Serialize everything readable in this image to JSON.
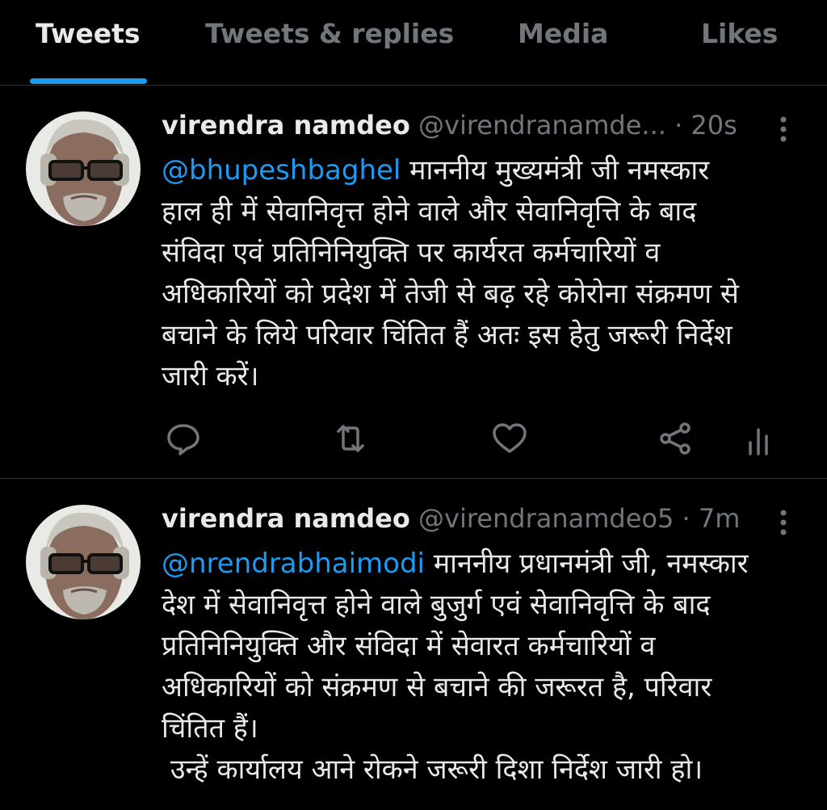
{
  "tabs": [
    {
      "label": "Tweets",
      "active": true
    },
    {
      "label": "Tweets & replies",
      "active": false
    },
    {
      "label": "Media",
      "active": false
    },
    {
      "label": "Likes",
      "active": false
    }
  ],
  "tweets": [
    {
      "author_name": "virendra namdeo",
      "author_handle": "@virendranamde...",
      "separator": " · ",
      "time": "20s",
      "mention": "@bhupeshbaghel",
      "text": " माननीय मुख्यमंत्री जी नमस्कार\nहाल ही में सेवानिवृत्त होने वाले और सेवानिवृत्ति के बाद\nसंविदा एवं प्रतिनिनियुक्ति पर कार्यरत कर्मचारियों व\nअधिकारियों को प्रदेश में तेजी से बढ़ रहे कोरोना संक्रमण से\nबचाने के लिये परिवार चिंतित हैं अतः इस हेतु जरूरी निर्देश\nजारी करें।",
      "actions": [
        "reply-icon",
        "retweet-icon",
        "like-icon",
        "share-icon",
        "analytics-icon"
      ]
    },
    {
      "author_name": "virendra namdeo",
      "author_handle": "@virendranamdeo5",
      "separator": " · ",
      "time": "7m",
      "mention": "@nrendrabhaimodi",
      "text": " माननीय प्रधानमंत्री जी, नमस्कार\nदेश में सेवानिवृत्त होने वाले बुजुर्ग एवं सेवानिवृत्ति के बाद\nप्रतिनिनियुक्ति और संविदा में सेवारत कर्मचारियों व\nअधिकारियों को संक्रमण से बचाने की जरूरत है, परिवार\nचिंतित हैं।\n उन्हें कार्यालय आने रोकने जरूरी दिशा निर्देश जारी हो।"
    }
  ],
  "colors": {
    "background": "#000000",
    "text": "#e7e9ea",
    "muted": "#71767b",
    "accent": "#1d9bf0",
    "divider": "#2f3336"
  }
}
